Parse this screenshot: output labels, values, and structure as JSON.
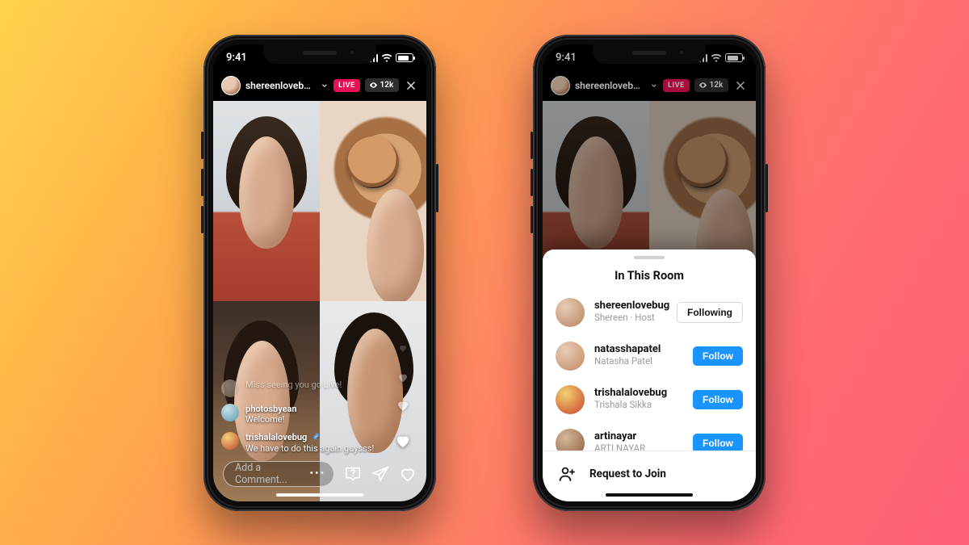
{
  "status": {
    "time": "9:41"
  },
  "live": {
    "host_line": "shereenlovebug, n...",
    "badge": "LIVE",
    "viewers": "12k"
  },
  "comments": [
    {
      "user": "",
      "text": "Miss seeing you go Live!",
      "verified": false
    },
    {
      "user": "photosbyean",
      "text": "Welcome!",
      "verified": false
    },
    {
      "user": "trishalalovebug",
      "text": "We have to do this again guysss!",
      "verified": true
    }
  ],
  "composer": {
    "placeholder": "Add a Comment..."
  },
  "sheet": {
    "title": "In This Room",
    "participants": [
      {
        "username": "shereenlovebug",
        "subtitle": "Shereen · Host",
        "state": "following",
        "btn": "Following"
      },
      {
        "username": "natasshapatel",
        "subtitle": "Natasha Patel",
        "state": "follow",
        "btn": "Follow"
      },
      {
        "username": "trishalalovebug",
        "subtitle": "Trishala Sikka",
        "state": "follow",
        "btn": "Follow"
      },
      {
        "username": "artinayar",
        "subtitle": "ARTI NAYAR",
        "state": "follow",
        "btn": "Follow"
      }
    ],
    "request_label": "Request to Join"
  }
}
